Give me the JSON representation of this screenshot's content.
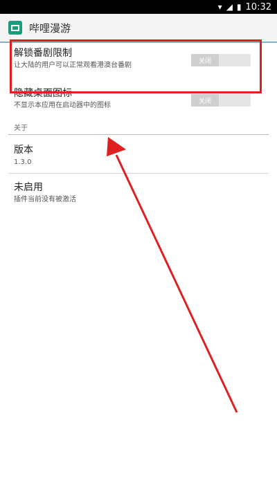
{
  "status_bar": {
    "time": "10:32",
    "icons": [
      "wifi-icon",
      "signal-icon",
      "battery-icon"
    ]
  },
  "app_bar": {
    "title": "哔哩漫游",
    "icon": "app-icon"
  },
  "settings": [
    {
      "title": "解锁番剧限制",
      "summary": "让大陆的用户可以正常观看港澳台番剧",
      "toggle_label": "关闭"
    },
    {
      "title": "隐藏桌面图标",
      "summary": "不显示本应用在启动器中的图标",
      "toggle_label": "关闭"
    }
  ],
  "about_section": {
    "header": "关于",
    "items": [
      {
        "title": "版本",
        "summary": "1.3.0"
      },
      {
        "title": "未启用",
        "summary": "插件当前没有被激活"
      }
    ]
  },
  "annotation": {
    "highlight_color": "#e02020",
    "arrow_color": "#e02020"
  }
}
